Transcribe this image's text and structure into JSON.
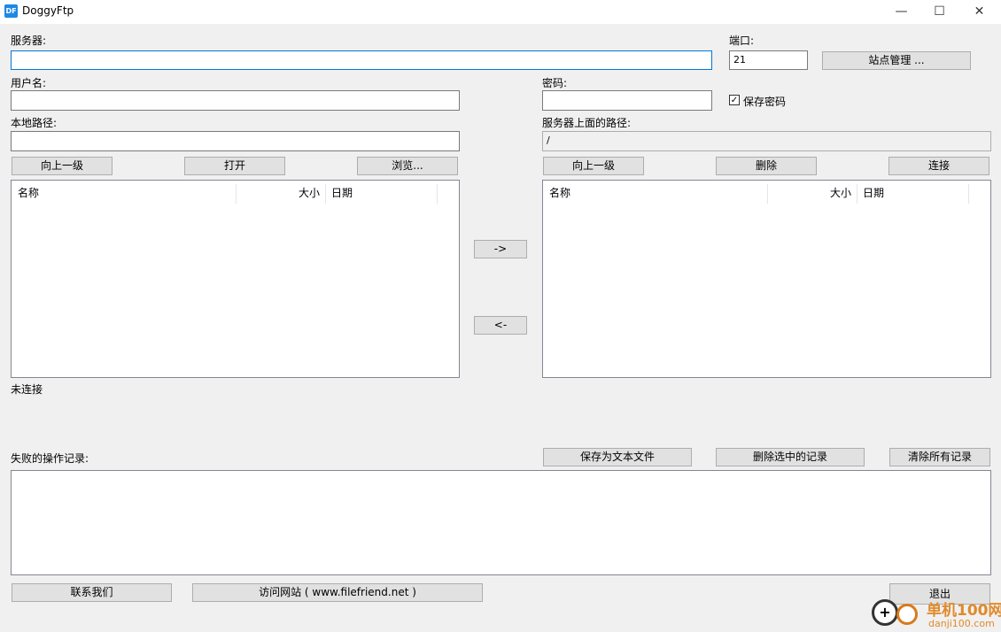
{
  "window": {
    "title": "DoggyFtp",
    "app_icon_text": "DF",
    "minimize": "—",
    "maximize": "☐",
    "close": "✕"
  },
  "server": {
    "label": "服务器:",
    "value": ""
  },
  "port": {
    "label": "端口:",
    "value": "21"
  },
  "site_manager_button": "站点管理 ...",
  "username": {
    "label": "用户名:",
    "value": ""
  },
  "password": {
    "label": "密码:",
    "value": ""
  },
  "save_password": {
    "label": "保存密码",
    "checked": true,
    "check_glyph": "✓"
  },
  "local_path": {
    "label": "本地路径:",
    "value": ""
  },
  "remote_path": {
    "label": "服务器上面的路径:",
    "value": "/"
  },
  "local_buttons": {
    "up": "向上一级",
    "open": "打开",
    "browse": "浏览..."
  },
  "remote_buttons": {
    "up": "向上一级",
    "delete": "删除",
    "connect": "连接"
  },
  "local_list": {
    "columns": [
      "名称",
      "大小",
      "日期"
    ],
    "rows": []
  },
  "remote_list": {
    "columns": [
      "名称",
      "大小",
      "日期"
    ],
    "rows": []
  },
  "transfer": {
    "upload": "->",
    "download": "<-"
  },
  "status": "未连接",
  "failed_log": {
    "label": "失败的操作记录:",
    "save_as_text": "保存为文本文件",
    "delete_selected": "删除选中的记录",
    "clear_all": "清除所有记录",
    "entries": []
  },
  "bottom": {
    "contact": "联系我们",
    "visit_site": "访问网站 ( www.filefriend.net )",
    "exit": "退出"
  },
  "watermark": {
    "text": "单机100网",
    "url": "danji100.com"
  }
}
